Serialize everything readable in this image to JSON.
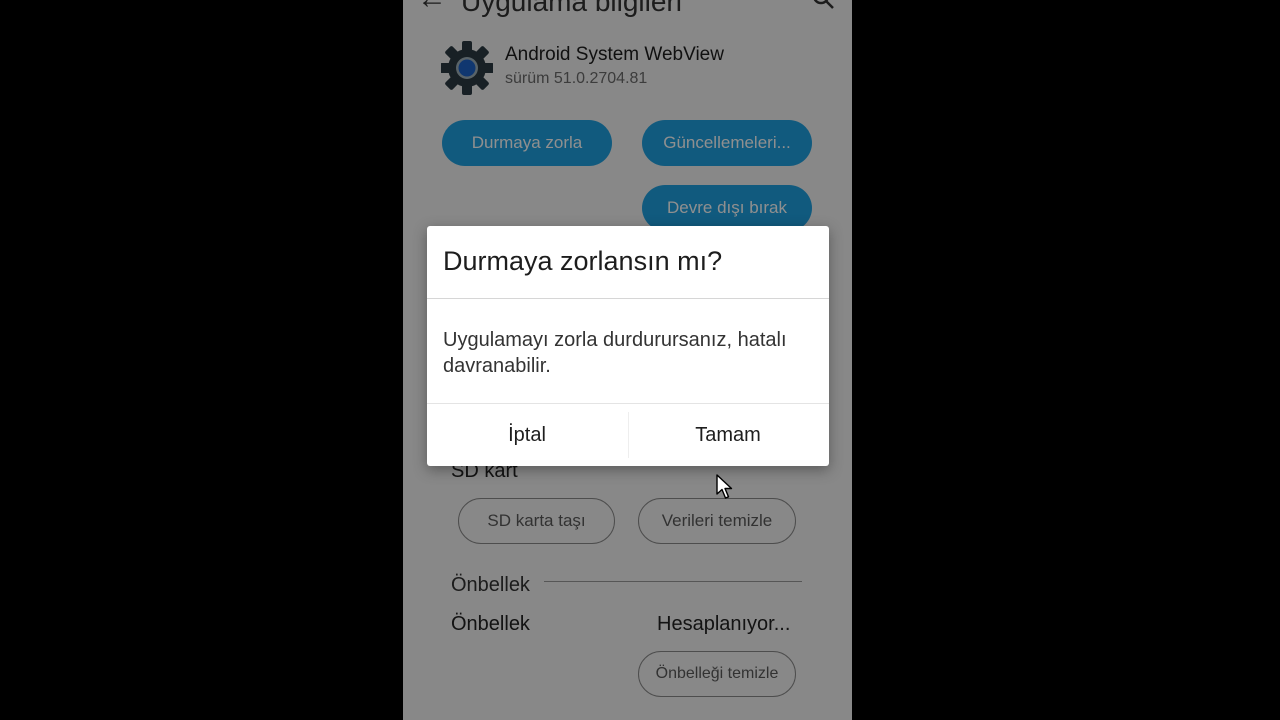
{
  "app_bar": {
    "title": "Uygulama bilgileri",
    "back_icon": "arrow-back-icon",
    "search_icon": "search-icon"
  },
  "app": {
    "name": "Android System WebView",
    "version": "sürüm 51.0.2704.81",
    "icon": "gear-icon"
  },
  "actions": {
    "force_stop": "Durmaya zorla",
    "updates": "Güncellemeleri...",
    "disable": "Devre dışı bırak"
  },
  "storage": {
    "sd_card_label": "SD kart",
    "move_to_sd": "SD karta taşı",
    "clear_data": "Verileri temizle"
  },
  "cache": {
    "section_title": "Önbellek",
    "label": "Önbellek",
    "value": "Hesaplanıyor...",
    "clear_button": "Önbelleği temizle"
  },
  "dialog": {
    "title": "Durmaya zorlansın mı?",
    "message": "Uygulamayı zorla durdurursanız, hatalı davranabilir.",
    "cancel": "İptal",
    "ok": "Tamam"
  },
  "colors": {
    "accent": "#1fa0e0",
    "gear": "#2b3a42",
    "gear_center": "#1e63c8"
  }
}
